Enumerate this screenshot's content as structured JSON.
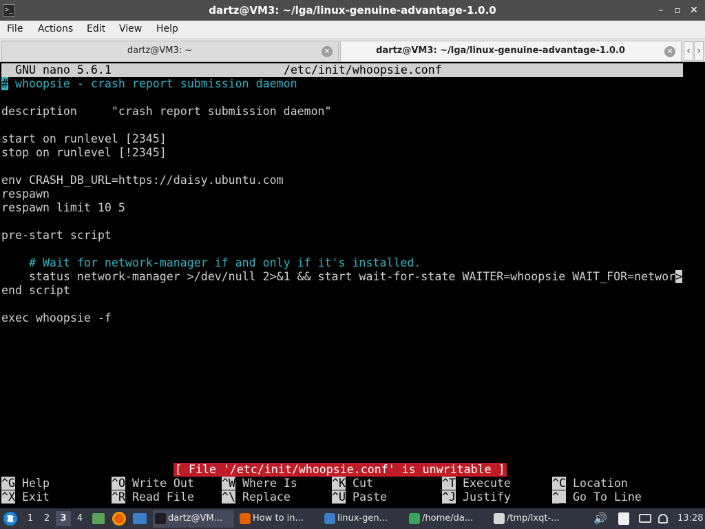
{
  "window": {
    "title": "dartz@VM3: ~/lga/linux-genuine-advantage-1.0.0",
    "minimize": "–",
    "maximize": "▫",
    "close": "✕"
  },
  "menu": [
    "File",
    "Actions",
    "Edit",
    "View",
    "Help"
  ],
  "tabs": [
    {
      "label": "dartz@VM3: ~"
    },
    {
      "label": "dartz@VM3: ~/lga/linux-genuine-advantage-1.0.0"
    }
  ],
  "nano": {
    "version": "GNU nano 5.6.1",
    "filename": "/etc/init/whoopsie.conf",
    "lines": [
      {
        "cursor": "#",
        "text": " whoopsie - crash report submission daemon",
        "kind": "comment"
      },
      {
        "text": "",
        "kind": "plain"
      },
      {
        "text": "description     \"crash report submission daemon\"",
        "kind": "plain"
      },
      {
        "text": "",
        "kind": "plain"
      },
      {
        "text": "start on runlevel [2345]",
        "kind": "plain"
      },
      {
        "text": "stop on runlevel [!2345]",
        "kind": "plain"
      },
      {
        "text": "",
        "kind": "plain"
      },
      {
        "text": "env CRASH_DB_URL=https://daisy.ubuntu.com",
        "kind": "plain"
      },
      {
        "text": "respawn",
        "kind": "plain"
      },
      {
        "text": "respawn limit 10 5",
        "kind": "plain"
      },
      {
        "text": "",
        "kind": "plain"
      },
      {
        "text": "pre-start script",
        "kind": "plain"
      },
      {
        "text": "",
        "kind": "plain"
      },
      {
        "text": "    # Wait for network-manager if and only if it's installed.",
        "kind": "comment"
      },
      {
        "text": "    status network-manager >/dev/null 2>&1 && start wait-for-state WAITER=whoopsie WAIT_FOR=networ",
        "kind": "plain",
        "overflow": ">"
      },
      {
        "text": "end script",
        "kind": "plain"
      },
      {
        "text": "",
        "kind": "plain"
      },
      {
        "text": "exec whoopsie -f",
        "kind": "plain"
      }
    ],
    "status_message": "[ File '/etc/init/whoopsie.conf' is unwritable ]",
    "shortcuts_row1": [
      {
        "key": "^G",
        "label": "Help"
      },
      {
        "key": "^O",
        "label": "Write Out"
      },
      {
        "key": "^W",
        "label": "Where Is"
      },
      {
        "key": "^K",
        "label": "Cut"
      },
      {
        "key": "^T",
        "label": "Execute"
      },
      {
        "key": "^C",
        "label": "Location"
      }
    ],
    "shortcuts_row2": [
      {
        "key": "^X",
        "label": "Exit"
      },
      {
        "key": "^R",
        "label": "Read File"
      },
      {
        "key": "^\\",
        "label": "Replace"
      },
      {
        "key": "^U",
        "label": "Paste"
      },
      {
        "key": "^J",
        "label": "Justify"
      },
      {
        "key": "^_",
        "label": "Go To Line"
      }
    ]
  },
  "taskbar": {
    "desktops": [
      "1",
      "2",
      "3",
      "4"
    ],
    "active_desktop": "3",
    "tasks": [
      {
        "label": "dartz@VM...",
        "icon": "terminal-icon",
        "color": "#1e1e1e"
      },
      {
        "label": "How to in...",
        "icon": "firefox-icon",
        "color": "#e66000"
      },
      {
        "label": "linux-gen...",
        "icon": "folder-icon",
        "color": "#3d7ec9"
      },
      {
        "label": "/home/da...",
        "icon": "archive-icon",
        "color": "#3aa55d"
      },
      {
        "label": "/tmp/lxqt-...",
        "icon": "editor-icon",
        "color": "#d8d8d8"
      }
    ],
    "clock": "13:28"
  },
  "colors": {
    "comment": "#2ab3c5",
    "status_bg": "#c01c28",
    "taskbar_bg": "#2f343f",
    "titlebar_bg": "#4c4c4c"
  }
}
